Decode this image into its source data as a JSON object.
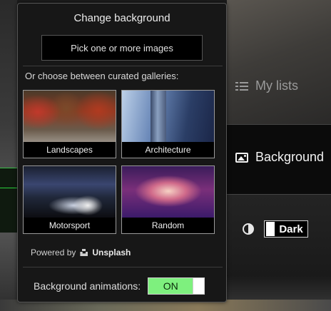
{
  "panel": {
    "title": "Change background",
    "pick_button": "Pick one or more images",
    "curated_label": "Or choose between curated galleries:",
    "galleries": [
      {
        "label": "Landscapes"
      },
      {
        "label": "Architecture"
      },
      {
        "label": "Motorsport"
      },
      {
        "label": "Random"
      }
    ],
    "powered_by": "Powered by",
    "provider": "Unsplash",
    "animations_label": "Background animations:",
    "animations_state": "ON"
  },
  "nav": {
    "my_lists": "My lists",
    "background": "Background",
    "theme_label": "Dark"
  },
  "colors": {
    "toggle_on": "#7ef07e",
    "panel_bg": "#171717"
  }
}
